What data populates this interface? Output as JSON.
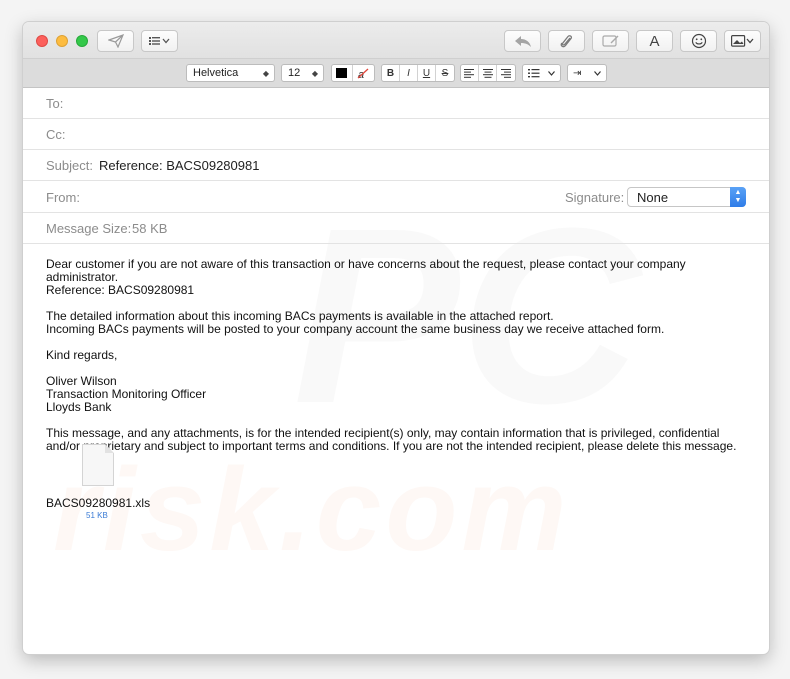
{
  "toolbar": {
    "send_icon": "paper-plane-icon",
    "header_fields_icon": "list-icon",
    "reply_icon": "reply-arrow-icon",
    "attach_icon": "paperclip-icon",
    "markup_icon": "markup-icon",
    "font_icon_label": "A",
    "emoji_icon": "smiley-icon",
    "photo_icon": "photo-browser-icon"
  },
  "format": {
    "font_family": "Helvetica",
    "font_size": "12",
    "bold": "B",
    "italic": "I",
    "underline": "U",
    "strike": "S"
  },
  "headers": {
    "to_label": "To:",
    "cc_label": "Cc:",
    "subject_label": "Subject:",
    "subject_value": "Reference: BACS09280981",
    "from_label": "From:",
    "signature_label": "Signature:",
    "signature_value": "None",
    "size_label": "Message Size:",
    "size_value": "58 KB"
  },
  "body": {
    "p1": "Dear customer if you are not aware of this transaction or have concerns about the request, please contact your company administrator.\nReference: BACS09280981",
    "p2": "The detailed information about this incoming BACs payments is available in the attached report.\nIncoming BACs payments will be posted to your company account the same business day we receive attached form.",
    "p3": "Kind regards,",
    "p4": "Oliver Wilson\nTransaction Monitoring Officer\nLloyds Bank",
    "p5": "This message, and any attachments, is for the intended recipient(s) only, may contain information that is privileged, confidential and/or proprietary and subject to important terms and conditions. If you are not the intended recipient, please delete this message."
  },
  "attachment": {
    "name": "BACS09280981.xls",
    "size": "51 KB"
  },
  "watermark": "risk.com"
}
